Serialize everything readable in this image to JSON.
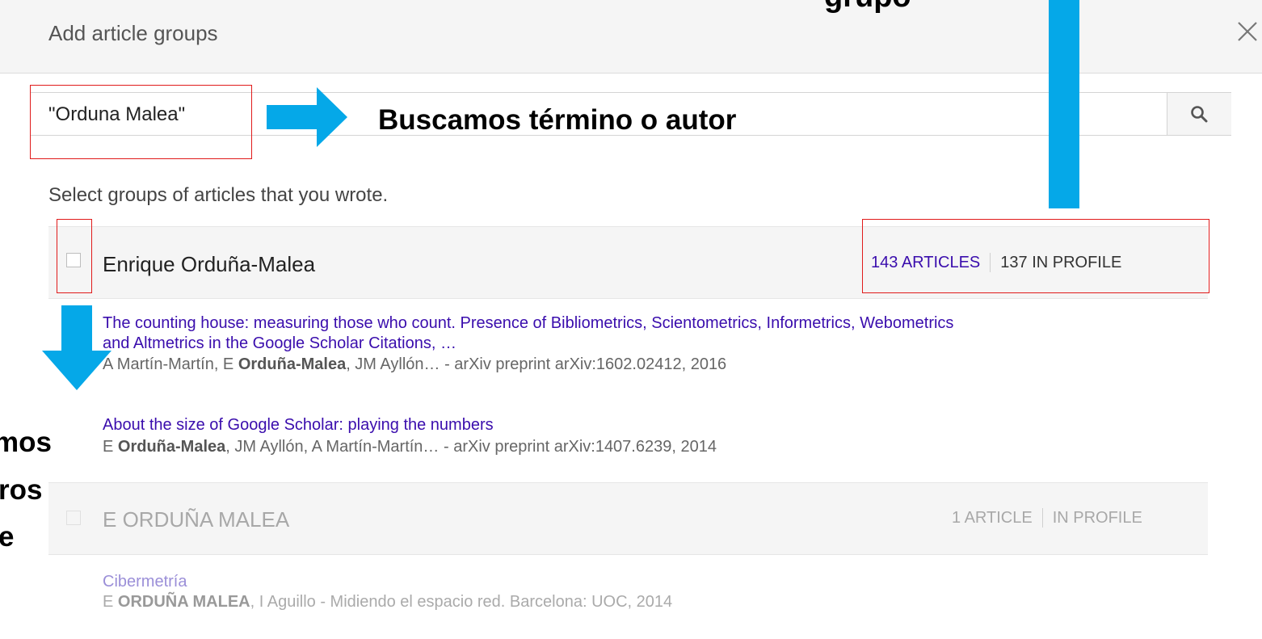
{
  "dialog": {
    "title": "Add article groups",
    "close_icon": "close-icon"
  },
  "search": {
    "value": "\"Orduna Malea\"",
    "button_icon": "search-icon"
  },
  "helper_text": "Select groups of articles that you wrote.",
  "groups": [
    {
      "name": "Enrique Orduña-Malea",
      "articles_label": "143 ARTICLES",
      "profile_label": "137 IN PROFILE",
      "enabled": true,
      "checked": false,
      "articles": [
        {
          "title_line1": "The counting house: measuring those who count. Presence of Bibliometrics, Scientometrics, Informetrics, Webometrics",
          "title_line2": "and Altmetrics in the Google Scholar Citations, …",
          "authors_pre": "A Martín-Martín, E ",
          "authors_bold": "Orduña-Malea",
          "authors_post": ", JM Ayllón… - arXiv preprint arXiv:1602.02412, 2016"
        },
        {
          "title_line1": "About the size of Google Scholar: playing the numbers",
          "authors_pre": "E ",
          "authors_bold": "Orduña-Malea",
          "authors_post": ", JM Ayllón, A Martín-Martín… - arXiv preprint arXiv:1407.6239, 2014"
        }
      ]
    },
    {
      "name": "E ORDUÑA MALEA",
      "articles_label": "1 ARTICLE",
      "profile_label": "IN PROFILE",
      "enabled": false,
      "checked": false,
      "articles": [
        {
          "title_line1": "Cibermetría",
          "authors_pre": "E ",
          "authors_bold": "ORDUÑA MALEA",
          "authors_post": ", I Aguillo - Midiendo el espacio red. Barcelona: UOC, 2014"
        }
      ]
    }
  ],
  "annotations": {
    "search_note": "Buscamos término o autor",
    "top_fragment": "grupo",
    "left_fragments": [
      "mos",
      "ros",
      "e"
    ],
    "arrow_color": "#05a8e8",
    "box_color": "#e01b1b"
  }
}
